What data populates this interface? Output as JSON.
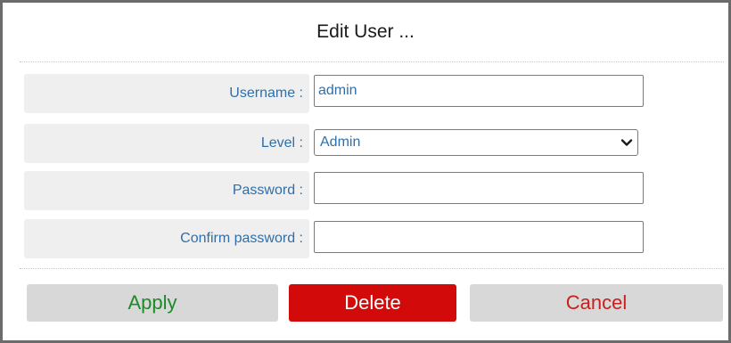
{
  "dialog": {
    "title": "Edit User ..."
  },
  "form": {
    "username": {
      "label": "Username :",
      "value": "admin"
    },
    "level": {
      "label": "Level :",
      "selected": "Admin"
    },
    "password": {
      "label": "Password :",
      "value": ""
    },
    "confirm_password": {
      "label": "Confirm password :",
      "value": ""
    }
  },
  "buttons": {
    "apply": "Apply",
    "delete": "Delete",
    "cancel": "Cancel"
  },
  "colors": {
    "label_text": "#2f6faa",
    "apply_text": "#1f8a2a",
    "delete_bg": "#d20a0a",
    "cancel_text": "#c81f1f"
  },
  "icons": {
    "level_dropdown": "chevron-down-icon"
  }
}
